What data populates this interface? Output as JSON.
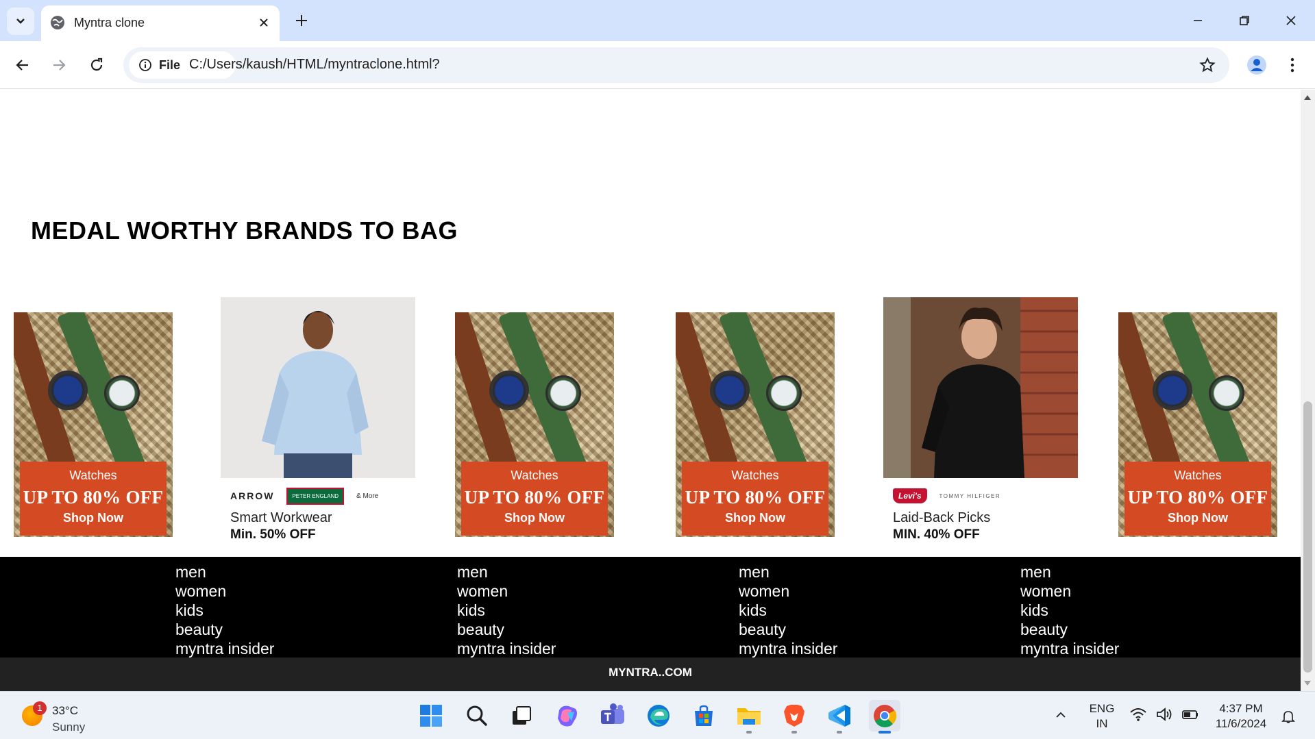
{
  "browser": {
    "tab_title": "Myntra clone",
    "site_chip_label": "File",
    "url": "C:/Users/kaush/HTML/myntraclone.html?"
  },
  "page": {
    "section_title": "MEDAL WORTHY BRANDS TO BAG",
    "cards": [
      {
        "kind": "watch",
        "line1": "Watches",
        "line2": "UP TO 80% OFF",
        "line3": "Shop Now"
      },
      {
        "kind": "photo",
        "brands": [
          "ARROW",
          "PETER ENGLAND",
          "& More"
        ],
        "caption": "Smart Workwear",
        "offer": "Min. 50% OFF"
      },
      {
        "kind": "watch",
        "line1": "Watches",
        "line2": "UP TO 80% OFF",
        "line3": "Shop Now"
      },
      {
        "kind": "watch",
        "line1": "Watches",
        "line2": "UP TO 80% OFF",
        "line3": "Shop Now"
      },
      {
        "kind": "photo",
        "brands": [
          "Levi's",
          "TOMMY HILFIGER"
        ],
        "caption": "Laid-Back Picks",
        "offer": "MIN. 40% OFF"
      },
      {
        "kind": "watch",
        "line1": "Watches",
        "line2": "UP TO 80% OFF",
        "line3": "Shop Now"
      }
    ],
    "footer_columns": [
      {
        "links": [
          "men",
          "women",
          "kids",
          "beauty",
          "myntra insider"
        ]
      },
      {
        "links": [
          "men",
          "women",
          "kids",
          "beauty",
          "myntra insider"
        ]
      },
      {
        "links": [
          "men",
          "women",
          "kids",
          "beauty",
          "myntra insider"
        ]
      },
      {
        "links": [
          "men",
          "women",
          "kids",
          "beauty",
          "myntra insider"
        ]
      }
    ],
    "footer_bottom": "MYNTRA..COM"
  },
  "taskbar": {
    "weather": {
      "temp": "33°C",
      "desc": "Sunny",
      "badge": "1"
    },
    "apps": [
      "windows-start",
      "search",
      "task-view",
      "copilot",
      "teams",
      "edge",
      "microsoft-store",
      "file-explorer",
      "brave",
      "vscode",
      "chrome"
    ],
    "lang_line1": "ENG",
    "lang_line2": "IN",
    "time": "4:37 PM",
    "date": "11/6/2024"
  },
  "colors": {
    "tabbar_bg": "#d3e3fd",
    "footer_bg": "#000000",
    "footer_bottom_bg": "#222222",
    "banner_orange": "#d44a22"
  }
}
